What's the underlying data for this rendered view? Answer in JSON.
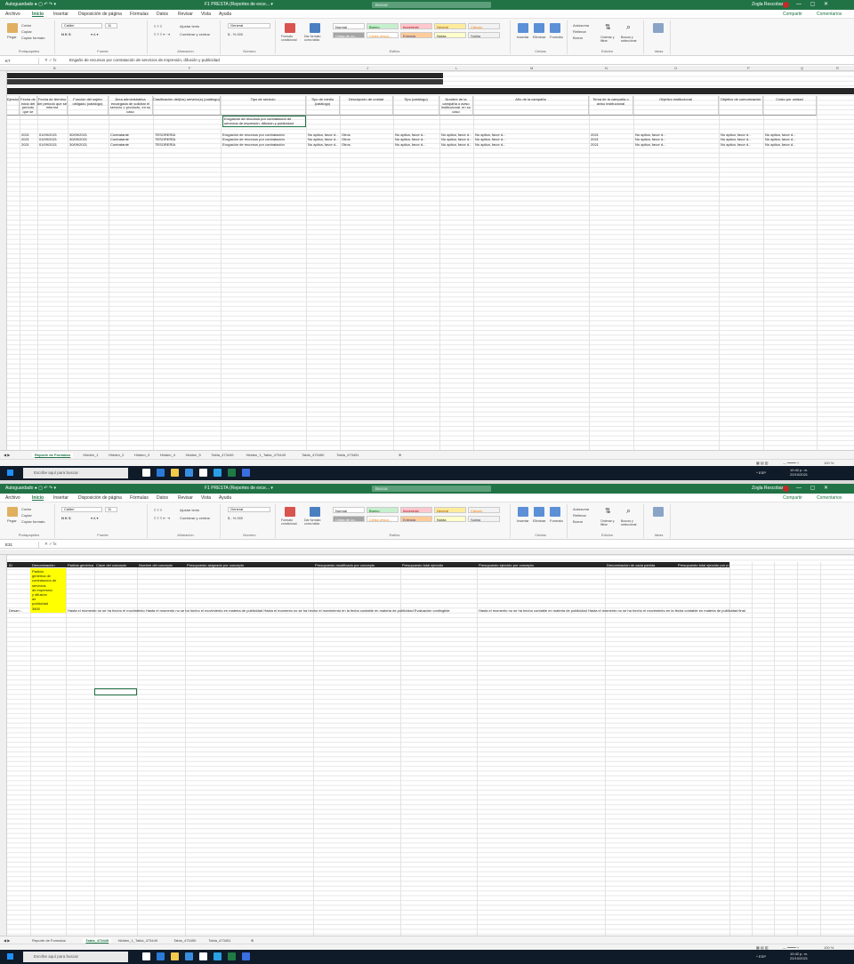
{
  "window": {
    "quick_access": "Autoguardado ● ▢ ↶ ↷ ▾",
    "title": "F1 PRESTA (Reportes de exce... ▾",
    "search_placeholder": "Buscar",
    "user": "Zogla Rescobar",
    "controls": "— ▢ ✕"
  },
  "ribbon_tabs": [
    "Archivo",
    "Inicio",
    "Insertar",
    "Disposición de página",
    "Fórmulas",
    "Datos",
    "Revisar",
    "Vista",
    "Ayuda"
  ],
  "active_tab": "Inicio",
  "share_label": "Compartir",
  "comments_label": "Comentarios",
  "ribbon": {
    "clipboard": {
      "paste": "Pegar",
      "cut": "Cortar",
      "copy": "Copiar",
      "format": "Copiar formato",
      "label": "Portapapeles"
    },
    "font": {
      "name": "Calibri",
      "size": "11",
      "label": "Fuente"
    },
    "alignment": {
      "wrap": "Ajustar texto",
      "merge": "Combinar y centrar",
      "label": "Alineación"
    },
    "number": {
      "format": "General",
      "symbols": "$ - % 000",
      "label": "Número"
    },
    "conditional": "Formato condicional",
    "as_table": "Dar formato como tabla",
    "styles": [
      {
        "name": "Normal",
        "bg": "#ffffff",
        "fg": "#222222"
      },
      {
        "name": "Bueno",
        "bg": "#c6efce",
        "fg": "#006100"
      },
      {
        "name": "Incorrecto",
        "bg": "#ffc7ce",
        "fg": "#9c0006"
      },
      {
        "name": "Neutral",
        "bg": "#ffeb9c",
        "fg": "#9c5700"
      },
      {
        "name": "Cálculo",
        "bg": "#f2f2f2",
        "fg": "#fa7d00"
      },
      {
        "name": "Celda de co...",
        "bg": "#a5a5a5",
        "fg": "#ffffff"
      },
      {
        "name": "Celda vincul...",
        "bg": "#ffffff",
        "fg": "#fa7d00"
      },
      {
        "name": "Entrada",
        "bg": "#ffcc99",
        "fg": "#3f3f76"
      },
      {
        "name": "Notas",
        "bg": "#ffffcc",
        "fg": "#222222"
      },
      {
        "name": "Salida",
        "bg": "#f2f2f2",
        "fg": "#3f3f3f"
      }
    ],
    "styles_label": "Estilos",
    "cells": {
      "insert": "Insertar",
      "delete": "Eliminar",
      "format": "Formato",
      "label": "Celdas"
    },
    "editing": {
      "autosum": "Autosuma",
      "fill": "Rellenar",
      "clear": "Borrar",
      "sort": "Ordenar y filtrar",
      "find": "Buscar y seleccionar",
      "label": "Edición"
    },
    "ideas": {
      "label": "Ideas"
    }
  },
  "shot1": {
    "namebox": "K7",
    "formula": "Engaño de recursos por contratación de servicios de impresión, difusión y publicidad",
    "band1": [
      "",
      "",
      "",
      "",
      ""
    ],
    "band2": "",
    "headers": [
      "Ejercicio",
      "Fecha de inicio del periodo que se informa",
      "Fecha de término del periodo que se informa",
      "Función del sujeto obligado (catálogo)",
      "Área administrativa encargada de solicitar el servicio o producto, en su caso",
      "Clasificación del(los) servicio(s) (catálogo)",
      "Tipo de servicio",
      "Tipo de medio (catálogo)",
      "Descripción de unidad",
      "Tipo (catálogo)",
      "Nombre de la campaña o aviso institucional, en su caso",
      "Año de la campaña",
      "Tema de la campaña o aviso institucional",
      "Objetivo institucional",
      "Objetivo de comunicación",
      "Costo por unidad"
    ],
    "k_continued": "Erogación de recursos por contratación de servicios de impresión, difusión y publicidad",
    "rows": [
      [
        "2021",
        "01/09/2021",
        "30/09/2021",
        "Contratante",
        "TESORERÍA",
        "Erogación de recursos por contratación",
        "No aplica, favor d...",
        "Otros",
        "No aplica, favor d...",
        "No aplica, favor d...",
        "No aplica, favor d...",
        "2021",
        "No aplica, favor d...",
        "No aplica, favor d...",
        "No aplica, favor d..."
      ],
      [
        "2021",
        "01/09/2021",
        "30/09/2021",
        "Contratante",
        "TESORERÍA",
        "Erogación de recursos por contratación",
        "No aplica, favor d...",
        "Otros",
        "No aplica, favor d...",
        "No aplica, favor d...",
        "No aplica, favor d...",
        "2021",
        "No aplica, favor d...",
        "No aplica, favor d...",
        "No aplica, favor d..."
      ],
      [
        "2021",
        "01/09/2021",
        "30/09/2021",
        "Contratante",
        "TESORERÍA",
        "Erogación de recursos por contratación",
        "No aplica, favor d...",
        "Otros",
        "No aplica, favor d...",
        "No aplica, favor d...",
        "No aplica, favor d...",
        "2021",
        "No aplica, favor d...",
        "No aplica, favor d...",
        "No aplica, favor d..."
      ]
    ],
    "sheet_tabs": [
      "Reporte de Formatos",
      "Hidden_1",
      "Hidden_2",
      "Hidden_3",
      "Hidden_4",
      "Hidden_5",
      "Tabla_473449",
      "Hidden_1_Tabla_473449",
      "Tabla_473450",
      "Tabla_473451"
    ],
    "active_sheet": "Reporte de Formatos"
  },
  "shot2": {
    "namebox": "E31",
    "formula": "",
    "headers": [
      "ID",
      "Denominación",
      "Partida genérica",
      "Clave del concepto",
      "Nombre del concepto",
      "Presupuesto asignado por concepto",
      "Presupuesto modificado por concepto",
      "Presupuesto total ejercido",
      "Presupuesto ejercido por concepto",
      "Denominación de cada partida",
      "Presupuesto total ejercido por partida"
    ],
    "yellow_lines": [
      "Partida",
      "genérica de",
      "contratación de",
      "servicios",
      "de impresión",
      "y difusión",
      "de",
      "publicidad",
      "3600"
    ],
    "row_id": "Desarr...",
    "row_text": "Hasta el momento no se ha hecho el movimiento    Hasta el momento no se ha hecho el movimiento en materia de publicidad    Hasta el momento no se ha hecho el movimiento en la fecha contable en materia de publicidad    Evaluación contingible",
    "row_text2": "Hasta el momento no se ha hecho contable en materia de publicidad    Hasta el momento no se ha hecho el movimiento en la fecha contable en materia de publicidad final",
    "sheet_tabs": [
      "Reporte de Formatos",
      "Tabla_473449",
      "Hidden_1_Tabla_473449",
      "Tabla_473450",
      "Tabla_473451"
    ],
    "active_sheet": "Tabla_473449"
  },
  "statusbar": {
    "zoom": "100 %"
  },
  "taskbar": {
    "search_placeholder": "Escribe aquí para buscar",
    "time": "10:42 p. m.",
    "date": "22/10/2021",
    "tray_text": "^ ESP"
  },
  "taskbar_icon_colors": [
    "#ffffff",
    "#2b7bd6",
    "#f2c94c",
    "#3a8dde",
    "#ffffff",
    "#2aa0e6",
    "#1f7a45",
    "#3b6ee0"
  ]
}
